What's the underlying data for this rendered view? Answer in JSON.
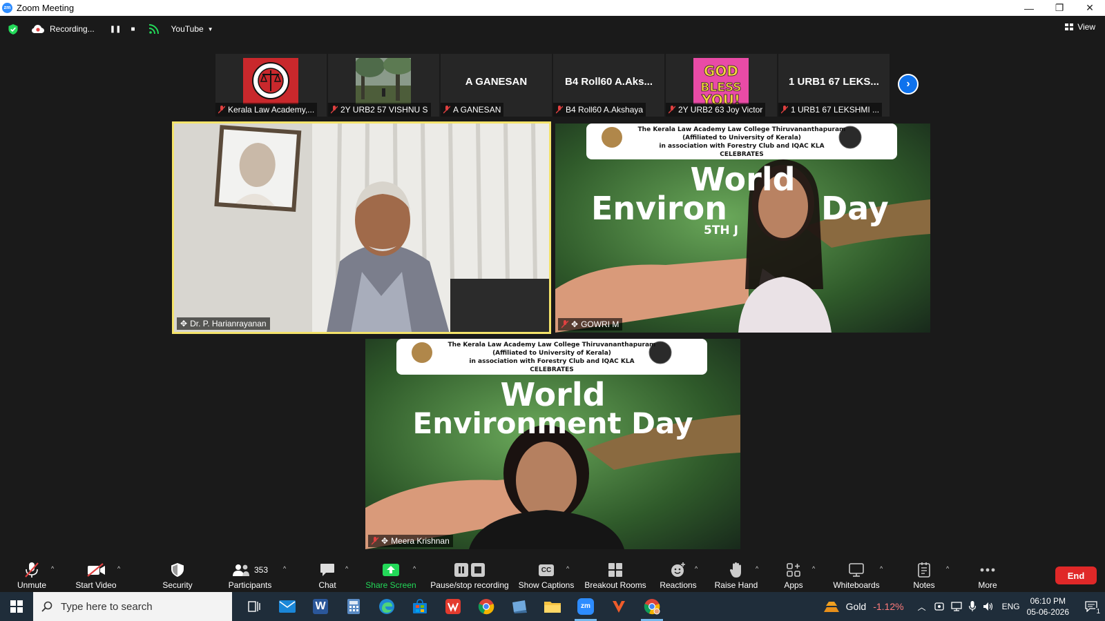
{
  "window": {
    "title": "Zoom Meeting",
    "app_icon": "zm",
    "minimize": "—",
    "restore": "❐",
    "close": "✕"
  },
  "topbar": {
    "recording_label": "Recording...",
    "pause_icon": "❚❚",
    "stop_icon": "■",
    "stream_target": "YouTube",
    "view_label": "View"
  },
  "gallery_strip": [
    {
      "label": "Kerala Law Academy,...",
      "display": "image",
      "icon": "law-academy-logo"
    },
    {
      "label": "2Y URB2 57 VISHNU S",
      "display": "image",
      "icon": "forest-photo"
    },
    {
      "label": "A GANESAN",
      "display": "name",
      "big_name": "A GANESAN"
    },
    {
      "label": "B4 Roll60 A.Akshaya",
      "display": "name",
      "big_name": "B4 Roll60 A.Aks..."
    },
    {
      "label": "2Y URB2 63 Joy Victor",
      "display": "image",
      "icon": "god-bless-you-image",
      "image_text": "GOD BLESS YOU"
    },
    {
      "label": "1 URB1 67 LEKSHMI ...",
      "display": "name",
      "big_name": "1 URB1 67 LEKS..."
    }
  ],
  "strip_next": "›",
  "videos": {
    "speaker": {
      "name": "Dr. P. Harianrayanan"
    },
    "gowri": {
      "name": "GOWRI M"
    },
    "meera": {
      "name": "Meera Krishnan"
    }
  },
  "banner": {
    "line1": "The Kerala Law Academy Law College Thiruvananthapuram",
    "line2": "(Affiliated to University of Kerala)",
    "line3": "in association with Forestry Club and IQAC KLA",
    "line4": "CELEBRATES",
    "title1": "World",
    "title2": "Environment Day",
    "title2_partial_left": "Environ",
    "title2_partial_right": "Day",
    "date": "5TH J"
  },
  "toolbar": {
    "unmute": "Unmute",
    "start_video": "Start Video",
    "security": "Security",
    "participants": "Participants",
    "participant_count": "353",
    "chat": "Chat",
    "share_screen": "Share Screen",
    "pause_recording": "Pause/stop recording",
    "captions": "Show Captions",
    "breakout": "Breakout Rooms",
    "reactions": "Reactions",
    "raise_hand": "Raise Hand",
    "apps": "Apps",
    "whiteboards": "Whiteboards",
    "notes": "Notes",
    "more": "More",
    "end": "End",
    "cc_glyph": "CC"
  },
  "taskbar": {
    "search_placeholder": "Type here to search",
    "gold_label": "Gold",
    "gold_change": "-1.12%",
    "language": "ENG",
    "time": "06:10 PM",
    "date": "05-06-2026",
    "notification_count": "1",
    "word_glyph": "W",
    "zoom_glyph": "zm"
  },
  "colors": {
    "accent_blue": "#0e72ed",
    "share_green": "#23d959",
    "end_red": "#e02828",
    "active_speaker_border": "#f4e36a",
    "muted_red": "#e04040"
  }
}
